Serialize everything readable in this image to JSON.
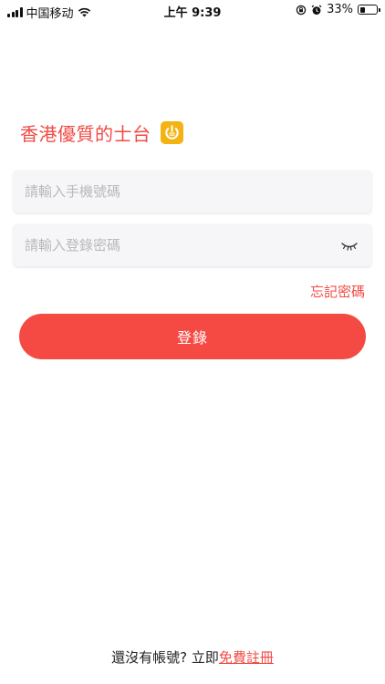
{
  "status_bar": {
    "carrier": "中国移动",
    "time": "上午 9:39",
    "battery": "33%",
    "battery_level": 0.33
  },
  "header": {
    "title": "香港優質的士台",
    "logo_icon": "power-taxi-logo-icon"
  },
  "form": {
    "phone_placeholder": "請輸入手機號碼",
    "password_placeholder": "請輸入登錄密碼",
    "password_toggle_icon": "eye-closed-icon",
    "forgot_label": "忘記密碼",
    "login_label": "登錄"
  },
  "footer": {
    "prompt": "還沒有帳號? 立即",
    "register_label": "免費註冊"
  },
  "colors": {
    "accent": "#f54a44",
    "logo": "#f2b313",
    "field_bg": "#f6f6f8"
  }
}
